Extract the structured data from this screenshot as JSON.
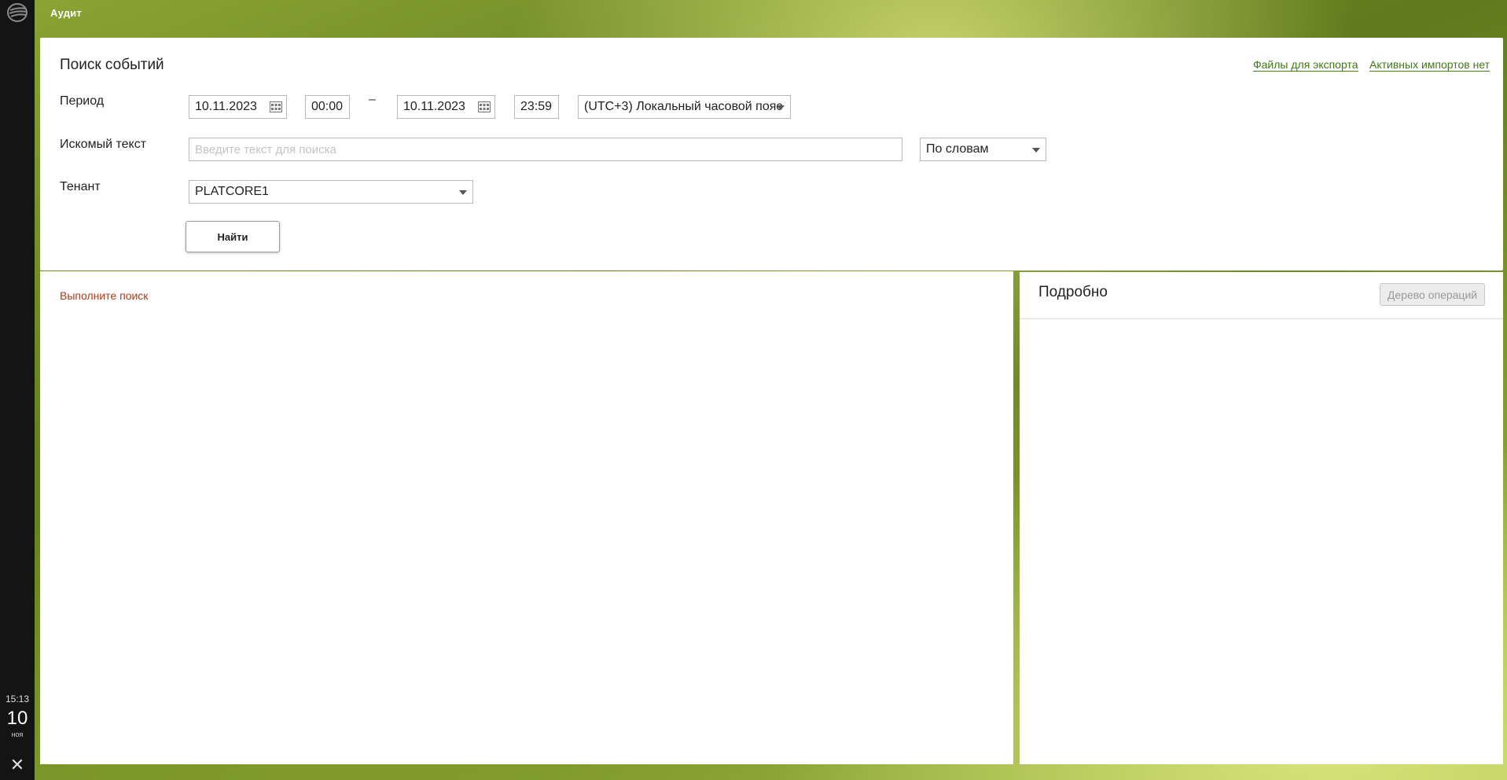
{
  "app": {
    "title": "Аудит"
  },
  "rail": {
    "time": "15:13",
    "day": "10",
    "month": "ноя",
    "close_glyph": "✕",
    "logo_icon": "bank-logo-icon",
    "close_icon": "close-icon"
  },
  "search": {
    "title": "Поиск событий",
    "export_files_link": "Файлы для экспорта",
    "imports_link": "Активных импортов нет",
    "period_label": "Период",
    "date_from": "10.11.2023",
    "time_from": "00:00",
    "range_dash": "–",
    "date_to": "10.11.2023",
    "time_to": "23:59",
    "timezone": "(UTC+3) Локальный часовой пояс",
    "text_label": "Искомый текст",
    "text_placeholder": "Введите текст для поиска",
    "text_value": "",
    "match_mode": "По словам",
    "tenant_label": "Тенант",
    "tenant_value": "PLATCORE1",
    "find_button": "Найти"
  },
  "results": {
    "hint": "Выполните поиск"
  },
  "details": {
    "title": "Подробно",
    "tree_button": "Дерево операций"
  },
  "colors": {
    "link": "#3f7a16",
    "hint": "#b03a17",
    "rail": "#141414"
  }
}
